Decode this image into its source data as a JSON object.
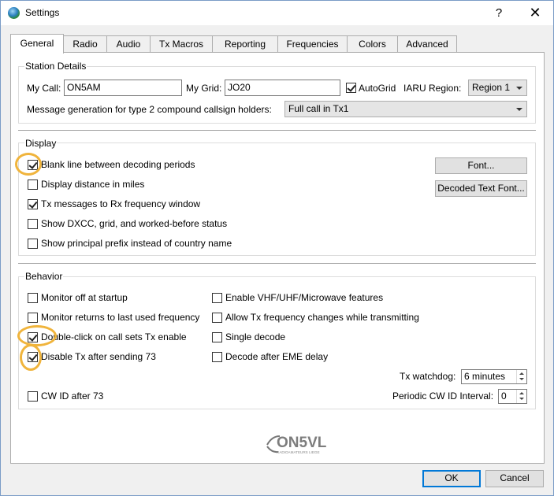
{
  "window": {
    "title": "Settings",
    "help_glyph": "?",
    "close_glyph": "✕"
  },
  "tabs": [
    {
      "label": "General",
      "active": true
    },
    {
      "label": "Radio"
    },
    {
      "label": "Audio"
    },
    {
      "label": "Tx Macros"
    },
    {
      "label": "Reporting"
    },
    {
      "label": "Frequencies"
    },
    {
      "label": "Colors"
    },
    {
      "label": "Advanced"
    }
  ],
  "station": {
    "title": "Station Details",
    "my_call_label": "My Call:",
    "my_call_value": "ON5AM",
    "my_grid_label": "My Grid:",
    "my_grid_value": "JO20",
    "autogrid_label": "AutoGrid",
    "autogrid_checked": true,
    "iaru_label": "IARU Region:",
    "iaru_value": "Region 1",
    "msg_gen_label": "Message generation for type 2 compound callsign holders:",
    "msg_gen_value": "Full call in Tx1"
  },
  "display": {
    "title": "Display",
    "options": [
      {
        "label": "Blank line between decoding periods",
        "checked": true
      },
      {
        "label": "Display distance in miles",
        "checked": false
      },
      {
        "label": "Tx messages to Rx frequency window",
        "checked": true
      },
      {
        "label": "Show DXCC, grid, and worked-before status",
        "checked": false
      },
      {
        "label": "Show principal prefix instead of country name",
        "checked": false
      }
    ],
    "font_button": "Font...",
    "decoded_font_button": "Decoded Text Font..."
  },
  "behavior": {
    "title": "Behavior",
    "left_options": [
      {
        "label": "Monitor off at startup",
        "checked": false
      },
      {
        "label": "Monitor returns to last used frequency",
        "checked": false
      },
      {
        "label": "Double-click on call sets Tx enable",
        "checked": true
      },
      {
        "label": "Disable Tx after sending 73",
        "checked": true
      }
    ],
    "right_options": [
      {
        "label": "Enable VHF/UHF/Microwave features",
        "checked": false
      },
      {
        "label": "Allow Tx frequency changes while transmitting",
        "checked": false
      },
      {
        "label": "Single decode",
        "checked": false
      },
      {
        "label": "Decode after EME delay",
        "checked": false
      }
    ],
    "watchdog_label": "Tx watchdog:",
    "watchdog_value": "6 minutes",
    "cwid_label": "CW ID after 73",
    "cwid_checked": false,
    "cwid_interval_label": "Periodic CW ID Interval:",
    "cwid_interval_value": "0"
  },
  "logo": {
    "text": "ON5VL",
    "subtext": "RADIOAMATEURS LIEGE"
  },
  "footer": {
    "ok": "OK",
    "cancel": "Cancel"
  },
  "colors": {
    "highlight": "#f0b43c",
    "accent": "#0078d7"
  }
}
